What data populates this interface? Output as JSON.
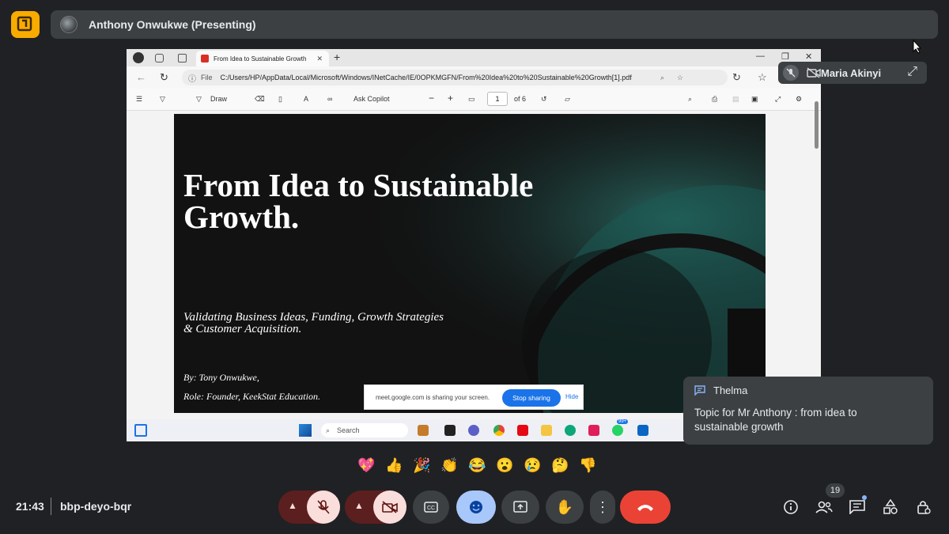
{
  "presenter": {
    "name": "Anthony Onwukwe (Presenting)"
  },
  "browser": {
    "tab_title": "From Idea to Sustainable Growth",
    "url_label": "File",
    "url": "C:/Users/HP/AppData/Local/Microsoft/Windows/INetCache/IE/0OPKMGFN/From%20Idea%20to%20Sustainable%20Growth[1].pdf"
  },
  "pdf_toolbar": {
    "draw_label": "Draw",
    "copilot_label": "Ask Copilot",
    "page_value": "1",
    "page_total": "of 6"
  },
  "slide": {
    "title": "From Idea to Sustainable Growth.",
    "subtitle": "Validating Business Ideas, Funding, Growth Strategies & Customer Acquisition.",
    "author": "By: Tony Onwukwe,",
    "role": "Role: Founder, KeekStat Education."
  },
  "share_notice": {
    "text": "meet.google.com is sharing your screen.",
    "stop_label": "Stop sharing",
    "hide_label": "Hide"
  },
  "taskbar": {
    "search_label": "Search",
    "badge": "99+"
  },
  "participant_tile": {
    "name": "Maria Akinyi"
  },
  "chat": {
    "sender": "Thelma",
    "message": "Topic for Mr Anthony : from idea to sustainable growth"
  },
  "reactions": [
    "💖",
    "👍",
    "🎉",
    "👏",
    "😂",
    "😮",
    "😢",
    "🤔",
    "👎"
  ],
  "meeting": {
    "time": "21:43",
    "code": "bbp-deyo-bqr"
  },
  "participants_count": "19",
  "colors": {
    "accent": "#a8c7fa",
    "end_call": "#ea4335",
    "app_logo": "#f9ab00",
    "slide_teal": "#1f6f68"
  }
}
